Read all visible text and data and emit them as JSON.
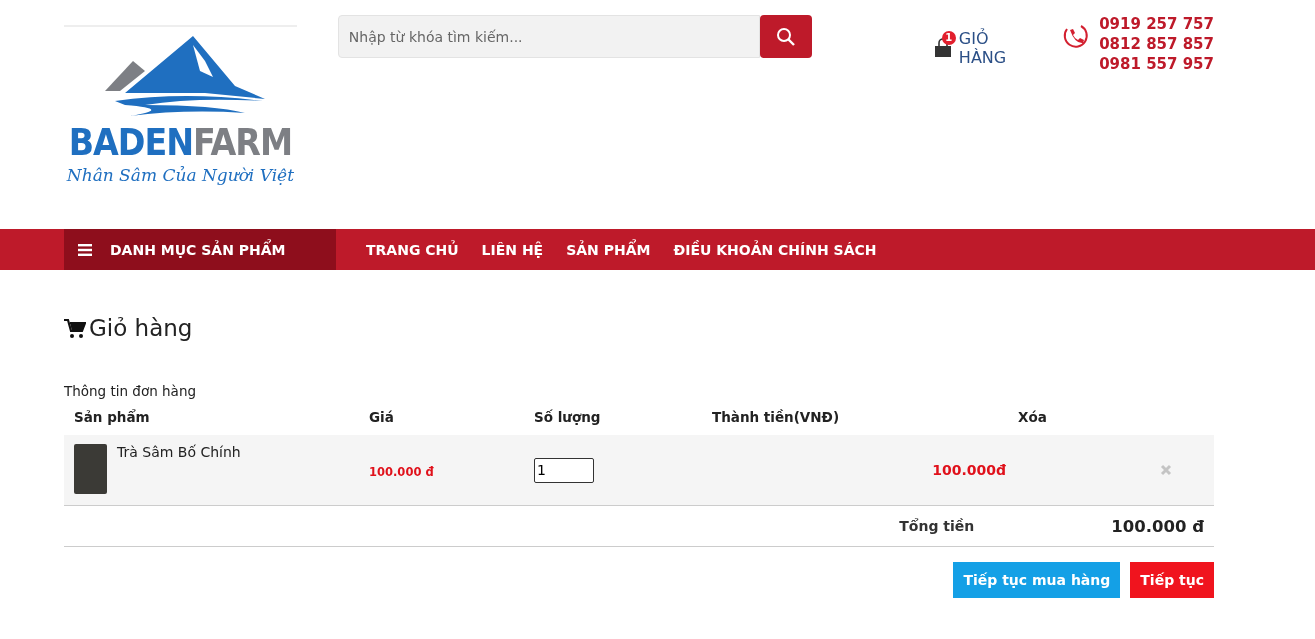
{
  "logo": {
    "brand_left": "BADEN",
    "brand_right": "FARM",
    "slogan": "Nhân Sâm Của Người Việt"
  },
  "search": {
    "placeholder": "Nhập từ khóa tìm kiếm..."
  },
  "cart_link": {
    "label": "GIỎ HÀNG",
    "count": "1"
  },
  "phones": [
    "0919 257 757",
    "0812 857 857",
    "0981 557 957"
  ],
  "nav": {
    "category": "DANH MỤC SẢN PHẨM",
    "items": [
      "TRANG CHỦ",
      "LIÊN HỆ",
      "SẢN PHẨM",
      "ĐIỀU KHOẢN CHÍNH SÁCH"
    ]
  },
  "page_title": "Giỏ hàng",
  "section_label": "Thông tin đơn hàng",
  "table": {
    "columns": [
      "Sản phẩm",
      "Giá",
      "Số lượng",
      "Thành tiền(VNĐ)",
      "Xóa"
    ],
    "rows": [
      {
        "product": "Trà Sâm Bố Chính",
        "price": "100.000 đ",
        "quantity": "1",
        "subtotal": "100.000đ"
      }
    ]
  },
  "total": {
    "label": "Tổng tiền",
    "value": "100.000 đ"
  },
  "buttons": {
    "continue_shopping": "Tiếp tục mua hàng",
    "checkout": "Tiếp tục"
  }
}
